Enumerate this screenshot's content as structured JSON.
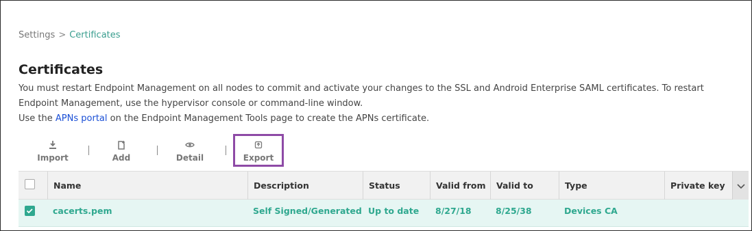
{
  "breadcrumb": {
    "parent": "Settings",
    "separator": ">",
    "current": "Certificates"
  },
  "page": {
    "title": "Certificates",
    "description_line1": "You must restart Endpoint Management on all nodes to commit and activate your changes to the SSL and Android Enterprise SAML certificates. To restart Endpoint Management, use the hypervisor console or command-line window.",
    "description_line2_prefix": "Use the",
    "description_link": "APNs portal",
    "description_line2_suffix": "on the Endpoint Management Tools page to create the APNs certificate."
  },
  "toolbar": {
    "import_label": "Import",
    "add_label": "Add",
    "detail_label": "Detail",
    "export_label": "Export"
  },
  "table": {
    "columns": [
      "Name",
      "Description",
      "Status",
      "Valid from",
      "Valid to",
      "Type",
      "Private key"
    ],
    "rows": [
      {
        "checked": true,
        "name": "cacerts.pem",
        "description": "Self Signed/Generated",
        "status": "Up to date",
        "valid_from": "8/27/18",
        "valid_to": "8/25/38",
        "type": "Devices CA",
        "private_key": ""
      }
    ]
  },
  "colors": {
    "accent": "#2fa88f",
    "highlight_box": "#8e4aa6",
    "link": "#1a4fd6",
    "row_selected": "#e6f6f3"
  }
}
